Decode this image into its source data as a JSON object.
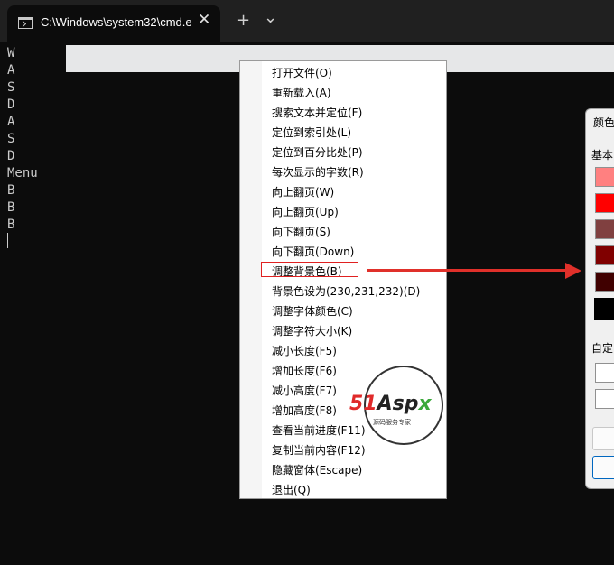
{
  "window": {
    "tab_title": "C:\\Windows\\system32\\cmd.e:",
    "close_glyph": "✕",
    "new_tab_glyph": "+",
    "dropdown_glyph": "⌄"
  },
  "terminal": {
    "lines": [
      "W",
      "A",
      "S",
      "D",
      "A",
      "S",
      "D",
      "Menu",
      "B",
      "B",
      "B"
    ]
  },
  "menu": {
    "items": [
      "打开文件(O)",
      "重新载入(A)",
      "搜索文本并定位(F)",
      "定位到索引处(L)",
      "定位到百分比处(P)",
      "每次显示的字数(R)",
      "向上翻页(W)",
      "向上翻页(Up)",
      "向下翻页(S)",
      "向下翻页(Down)",
      "调整背景色(B)",
      "背景色设为(230,231,232)(D)",
      "调整字体颜色(C)",
      "调整字符大小(K)",
      "减小长度(F5)",
      "增加长度(F6)",
      "减小高度(F7)",
      "增加高度(F8)",
      "查看当前进度(F11)",
      "复制当前内容(F12)",
      "隐藏窗体(Escape)",
      "退出(Q)"
    ]
  },
  "dialog": {
    "title": "颜色",
    "basic_label": "基本",
    "custom_label": "自定",
    "swatches": [
      "#ff8080",
      "#ff0000",
      "#804040",
      "#800000",
      "#400000",
      "#000000"
    ]
  },
  "watermark": {
    "brand": "51Aspx",
    "tagline": "源码服务专家"
  },
  "colors": {
    "annotation": "#e02020",
    "terminal_bg": "#0c0c0c"
  }
}
